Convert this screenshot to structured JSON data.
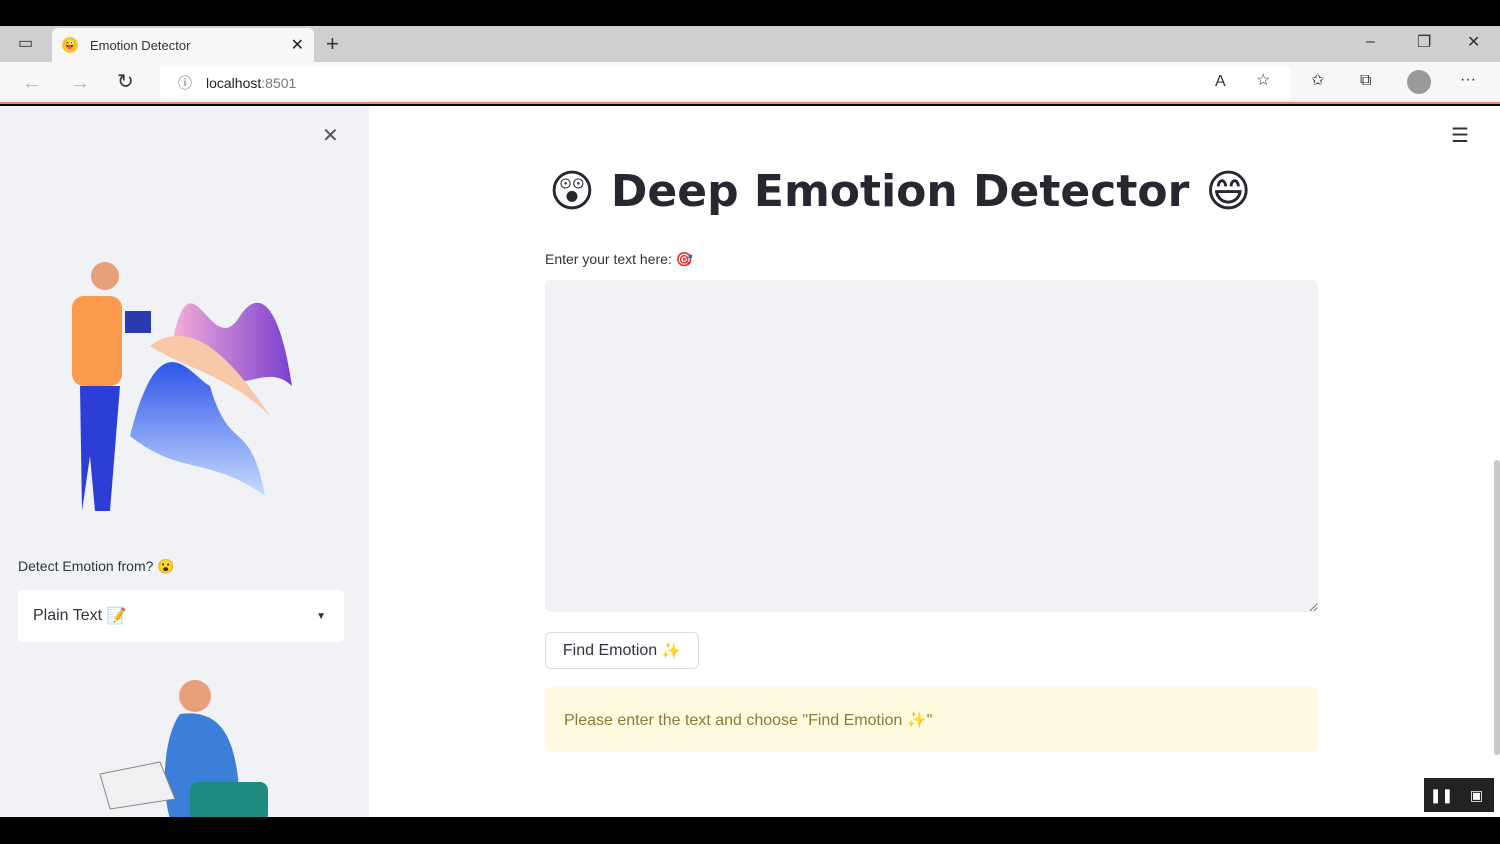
{
  "browser": {
    "tab_title": "Emotion Detector",
    "tab_favicon": "😜",
    "url_host": "localhost",
    "url_port": ":8501"
  },
  "sidebar": {
    "select_label": "Detect Emotion from?",
    "select_label_emoji": "😮",
    "select_value": "Plain Text",
    "select_value_emoji": "📝"
  },
  "main": {
    "title": "Deep Emotion Detector",
    "title_emoji_left": "😲",
    "title_emoji_right": "😄",
    "input_label": "Enter your text here:",
    "input_label_emoji": "🎯",
    "input_value": "",
    "button_label": "Find Emotion",
    "button_emoji": "✨",
    "alert_text": "Please enter the text and choose \"Find Emotion ✨\""
  }
}
